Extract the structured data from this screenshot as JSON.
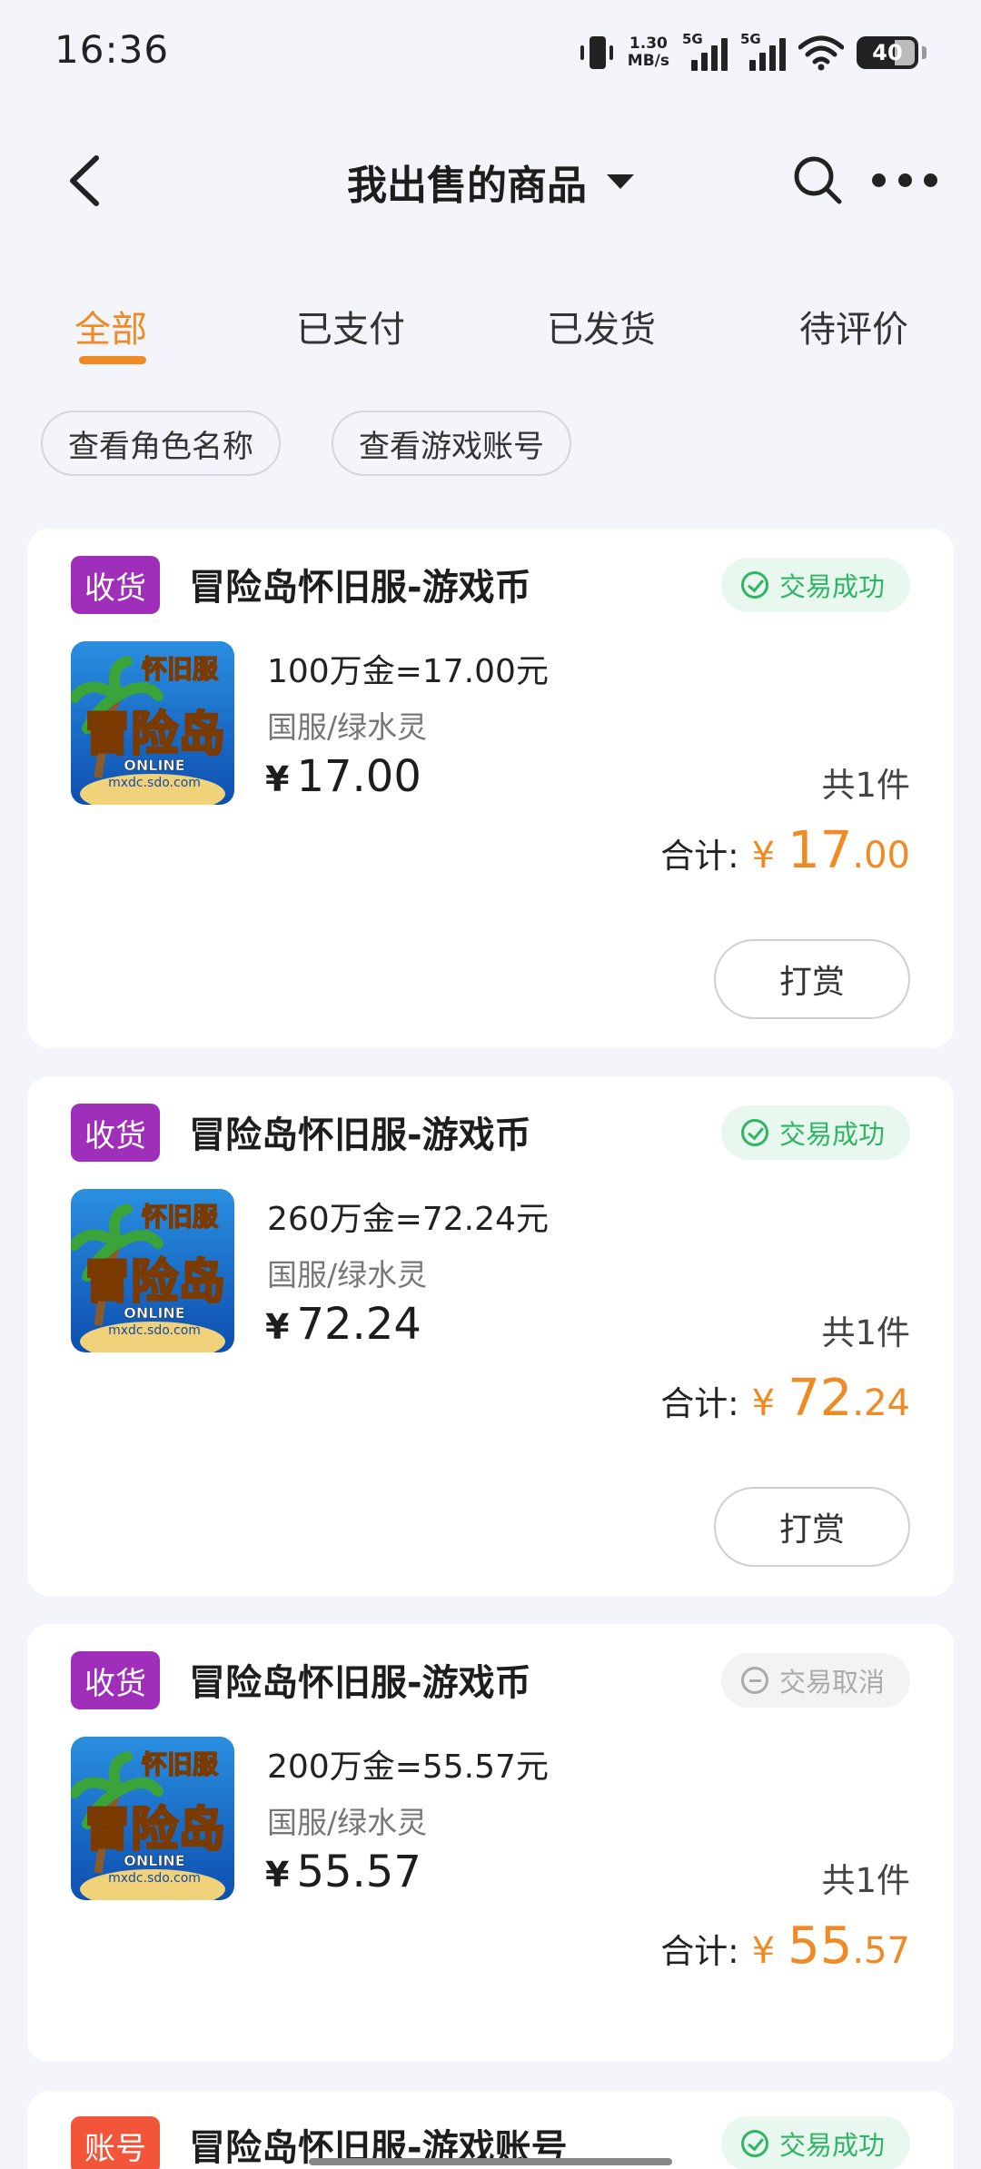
{
  "status_bar": {
    "time": "16:36",
    "net_speed_value": "1.30",
    "net_speed_unit": "MB/s",
    "signal1_label": "5G",
    "signal2_label": "5G",
    "battery": "40"
  },
  "nav": {
    "title": "我出售的商品"
  },
  "tabs": [
    {
      "label": "全部",
      "active": true
    },
    {
      "label": "已支付",
      "active": false
    },
    {
      "label": "已发货",
      "active": false
    },
    {
      "label": "待评价",
      "active": false
    }
  ],
  "filters": [
    {
      "label": "查看角色名称"
    },
    {
      "label": "查看游戏账号"
    }
  ],
  "orders": [
    {
      "tag": "收货",
      "title": "冒险岛怀旧服-游戏币",
      "status": "交易成功",
      "desc": "100万金=17.00元",
      "server": "国服/绿水灵",
      "currency": "¥",
      "unit_price": "17.00",
      "qty": "共1件",
      "total_label": "合计:",
      "total_int": "17",
      "total_dec": ".00",
      "action": "打赏"
    },
    {
      "tag": "收货",
      "title": "冒险岛怀旧服-游戏币",
      "status": "交易成功",
      "desc": "260万金=72.24元",
      "server": "国服/绿水灵",
      "currency": "¥",
      "unit_price": "72.24",
      "qty": "共1件",
      "total_label": "合计:",
      "total_int": "72",
      "total_dec": ".24",
      "action": "打赏"
    },
    {
      "tag": "收货",
      "title": "冒险岛怀旧服-游戏币",
      "status": "交易取消",
      "desc": "200万金=55.57元",
      "server": "国服/绿水灵",
      "currency": "¥",
      "unit_price": "55.57",
      "qty": "共1件",
      "total_label": "合计:",
      "total_int": "55",
      "total_dec": ".57"
    },
    {
      "tag": "账号",
      "title": "冒险岛怀旧服-游戏账号",
      "status": "交易成功"
    }
  ],
  "thumb": {
    "logo_top": "怀旧服",
    "logo_main": "冒险岛",
    "logo_sub": "ONLINE",
    "logo_url": "mxdc.sdo.com"
  },
  "colors": {
    "accent": "#f08a24",
    "tag_purple": "#9f2fba",
    "tag_red": "#f2553a",
    "success": "#2fb565"
  }
}
